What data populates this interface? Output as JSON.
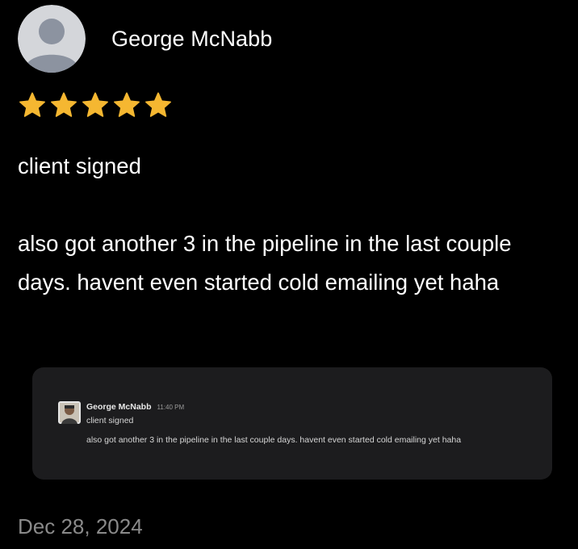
{
  "review": {
    "author_name": "George McNabb",
    "rating": 5,
    "rating_max": 5,
    "star_color": "#F5B731",
    "paragraphs": [
      "client signed",
      "also got another 3 in the pipeline in the last couple days. havent even started cold emailing yet haha"
    ],
    "date": "Dec 28, 2024"
  },
  "embedded_message": {
    "author_name": "George McNabb",
    "time": "11:40 PM",
    "line1": "client signed",
    "line2": "also got another 3 in the pipeline in the last couple days. havent even started cold emailing yet haha"
  },
  "icons": {
    "reviewer_avatar": "default-user-avatar-icon",
    "star": "star-icon",
    "message_avatar": "user-photo-avatar-icon"
  }
}
